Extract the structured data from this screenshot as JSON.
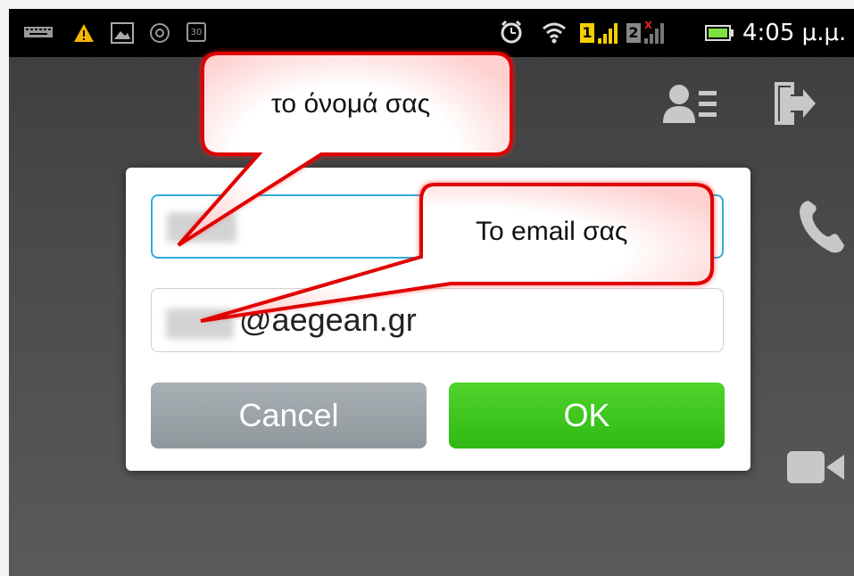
{
  "status_bar": {
    "time": "4:05 μ.μ.",
    "icons": [
      "keyboard-icon",
      "warning-icon",
      "image-icon",
      "at-sign-icon",
      "calendar-icon",
      "alarm-clock-icon",
      "wifi-icon",
      "sim1-signal-icon",
      "sim2-no-signal-icon",
      "battery-icon"
    ],
    "sim1_label": "1",
    "sim2_label": "2",
    "calendar_label": "30"
  },
  "actions": {
    "icons": [
      "contacts-menu-icon",
      "logout-icon",
      "phone-icon",
      "video-call-icon"
    ]
  },
  "dialog": {
    "name_field": {
      "value_visible": ""
    },
    "email_field": {
      "value_suffix": "@aegean.gr"
    },
    "cancel_label": "Cancel",
    "ok_label": "OK"
  },
  "annotations": {
    "name_callout": "το όνομά σας",
    "email_callout": "Το email σας",
    "color": "#e00000"
  }
}
